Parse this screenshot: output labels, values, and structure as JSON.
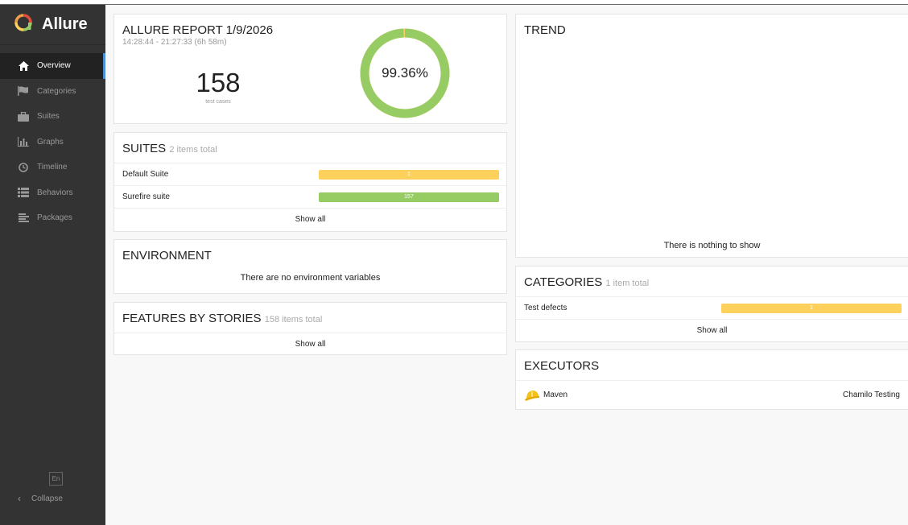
{
  "colors": {
    "passed": "#97cc64",
    "broken": "#fdd15c",
    "accent": "#4a90d9",
    "sidebar": "#333333"
  },
  "sidebar": {
    "brand": "Allure",
    "items": [
      {
        "label": "Overview",
        "icon": "home-icon",
        "active": true
      },
      {
        "label": "Categories",
        "icon": "flag-icon"
      },
      {
        "label": "Suites",
        "icon": "briefcase-icon"
      },
      {
        "label": "Graphs",
        "icon": "bar-chart-icon"
      },
      {
        "label": "Timeline",
        "icon": "clock-icon"
      },
      {
        "label": "Behaviors",
        "icon": "list-icon"
      },
      {
        "label": "Packages",
        "icon": "align-left-icon"
      }
    ],
    "language": "En",
    "collapse_label": "Collapse"
  },
  "summary": {
    "title": "ALLURE REPORT 1/9/2026",
    "time_range": "14:28:44 - 21:27:33 (6h 58m)",
    "test_count": "158",
    "test_count_label": "test cases",
    "success_rate": "99.36%",
    "success_fraction": 0.9936
  },
  "suites": {
    "title": "SUITES",
    "subtitle": "2 items total",
    "items": [
      {
        "name": "Default Suite",
        "value": "1",
        "status": "broken"
      },
      {
        "name": "Surefire suite",
        "value": "157",
        "status": "passed"
      }
    ],
    "show_all": "Show all"
  },
  "environment": {
    "title": "ENVIRONMENT",
    "message": "There are no environment variables"
  },
  "features": {
    "title": "FEATURES BY STORIES",
    "subtitle": "158 items total",
    "show_all": "Show all"
  },
  "trend": {
    "title": "TREND",
    "message": "There is nothing to show"
  },
  "categories": {
    "title": "CATEGORIES",
    "subtitle": "1 item total",
    "items": [
      {
        "name": "Test defects",
        "value": "1",
        "status": "broken"
      }
    ],
    "show_all": "Show all"
  },
  "executors": {
    "title": "EXECUTORS",
    "name": "Maven",
    "build": "Chamilo Testing"
  }
}
